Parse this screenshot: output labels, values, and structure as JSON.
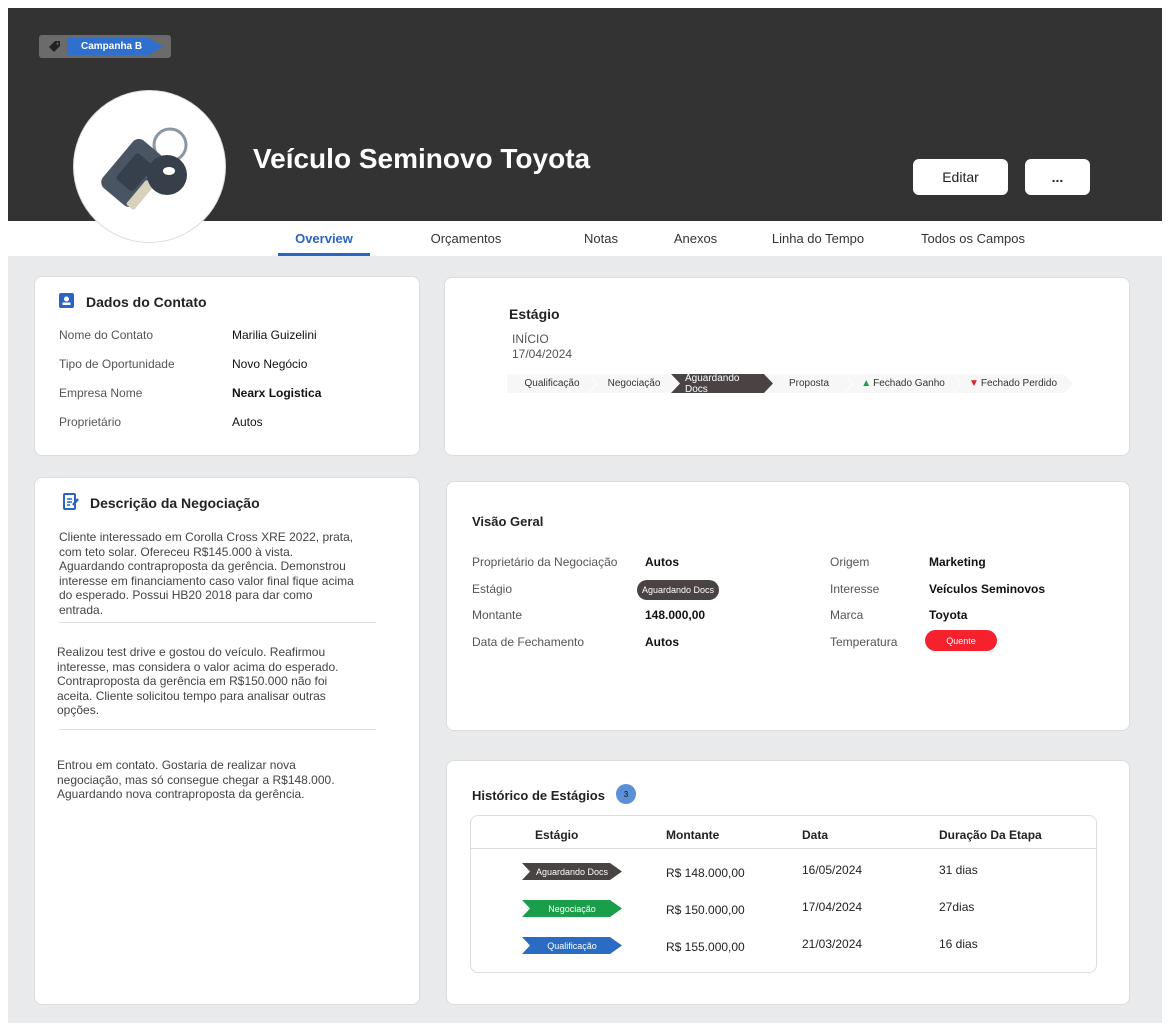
{
  "header": {
    "tag": "Campanha B",
    "title": "Veículo Seminovo Toyota",
    "edit_label": "Editar",
    "more_label": "..."
  },
  "tabs": [
    "Overview",
    "Orçamentos",
    "Notas",
    "Anexos",
    "Linha do Tempo",
    "Todos os Campos"
  ],
  "contact": {
    "title": "Dados do Contato",
    "rows": [
      {
        "label": "Nome do Contato",
        "value": "Marilia Guizelini"
      },
      {
        "label": "Tipo de Oportunidade",
        "value": "Novo Negócio"
      },
      {
        "label": "Empresa Nome",
        "value": "Nearx Logistica"
      },
      {
        "label": "Proprietário",
        "value": "Autos"
      }
    ]
  },
  "description": {
    "title": "Descrição da Negociação",
    "entries": [
      "Cliente interessado em Corolla Cross XRE 2022, prata, com teto solar. Ofereceu R$145.000 à vista. Aguardando contraproposta da gerência. Demonstrou interesse em financiamento caso valor final fique acima do esperado. Possui HB20 2018 para dar como entrada.",
      "Realizou test drive e gostou do veículo. Reafirmou interesse, mas considera o valor acima do esperado. Contraproposta da gerência em R$150.000 não foi aceita. Cliente solicitou tempo para analisar outras opções.",
      "Entrou em contato. Gostaria de realizar nova negociação, mas só consegue chegar a R$148.000. Aguardando nova contraproposta da gerência."
    ]
  },
  "stage": {
    "title": "Estágio",
    "start_label": "INÍCIO",
    "start_date": "17/04/2024",
    "steps": [
      "Qualificação",
      "Negociação",
      "Aguardando Docs",
      "Proposta",
      "Fechado Ganho",
      "Fechado Perdido"
    ],
    "active_step": "Aguardando Docs"
  },
  "overview": {
    "title": "Visão Geral",
    "left": [
      {
        "label": "Proprietário da Negociação",
        "value": "Autos"
      },
      {
        "label": "Estágio",
        "value": "Aguardando Docs"
      },
      {
        "label": "Montante",
        "value": "148.000,00"
      },
      {
        "label": "Data de Fechamento",
        "value": "Autos"
      }
    ],
    "right": [
      {
        "label": "Origem",
        "value": "Marketing"
      },
      {
        "label": "Interesse",
        "value": "Veículos Seminovos"
      },
      {
        "label": "Marca",
        "value": "Toyota"
      },
      {
        "label": "Temperatura",
        "value": "Quente"
      }
    ]
  },
  "history": {
    "title": "Histórico de Estágios",
    "count": "3",
    "columns": [
      "Estágio",
      "Montante",
      "Data",
      "Duração Da Etapa"
    ],
    "rows": [
      {
        "stage": "Aguardando Docs",
        "amount": "R$ 148.000,00",
        "date": "16/05/2024",
        "duration": "31 dias",
        "color": "#4a4343"
      },
      {
        "stage": "Negociação",
        "amount": "R$ 150.000,00",
        "date": "17/04/2024",
        "duration": "27dias",
        "color": "#1a9e4a"
      },
      {
        "stage": "Qualificação",
        "amount": "R$ 155.000,00",
        "date": "21/03/2024",
        "duration": "16 dias",
        "color": "#2a6bc4"
      }
    ]
  },
  "colors": {
    "accent": "#2a64c5",
    "header": "#333333",
    "hot": "#f5222d"
  }
}
